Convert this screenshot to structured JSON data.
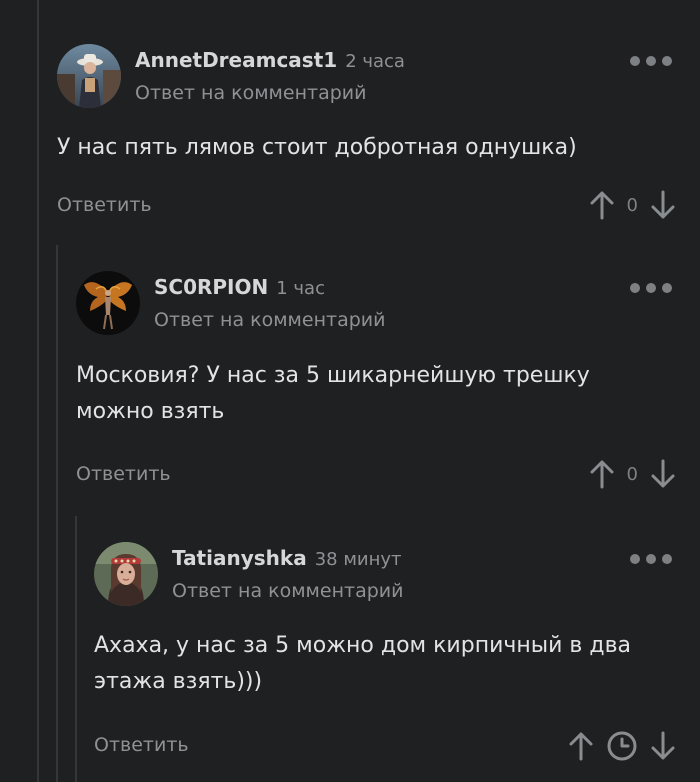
{
  "comments": [
    {
      "author": "AnnetDreamcast1",
      "time": "2 часа",
      "reply_to": "Ответ на комментарий",
      "text": "У нас пять лямов стоит добротная однушка)",
      "reply_label": "Ответить",
      "rating": "0",
      "avatar_icon": "woman-hat-photo"
    },
    {
      "author": "SC0RPION",
      "time": "1 час",
      "reply_to": "Ответ на комментарий",
      "text": "Московия? У нас за 5 шикарнейшую трешку можно взять",
      "reply_label": "Ответить",
      "rating": "0",
      "avatar_icon": "winged-figure-photo"
    },
    {
      "author": "Tatianyshka",
      "time": "38 минут",
      "reply_to": "Ответ на комментарий",
      "text": "Ахаха, у нас за 5 можно дом кирпичный в два этажа взять)))",
      "reply_label": "Ответить",
      "rating_status": "clock-icon",
      "avatar_icon": "woman-headband-photo"
    }
  ],
  "colors": {
    "background": "#1e2022",
    "text": "#e3e3e3",
    "muted": "#8f9295",
    "thread_line": "#34373a"
  }
}
